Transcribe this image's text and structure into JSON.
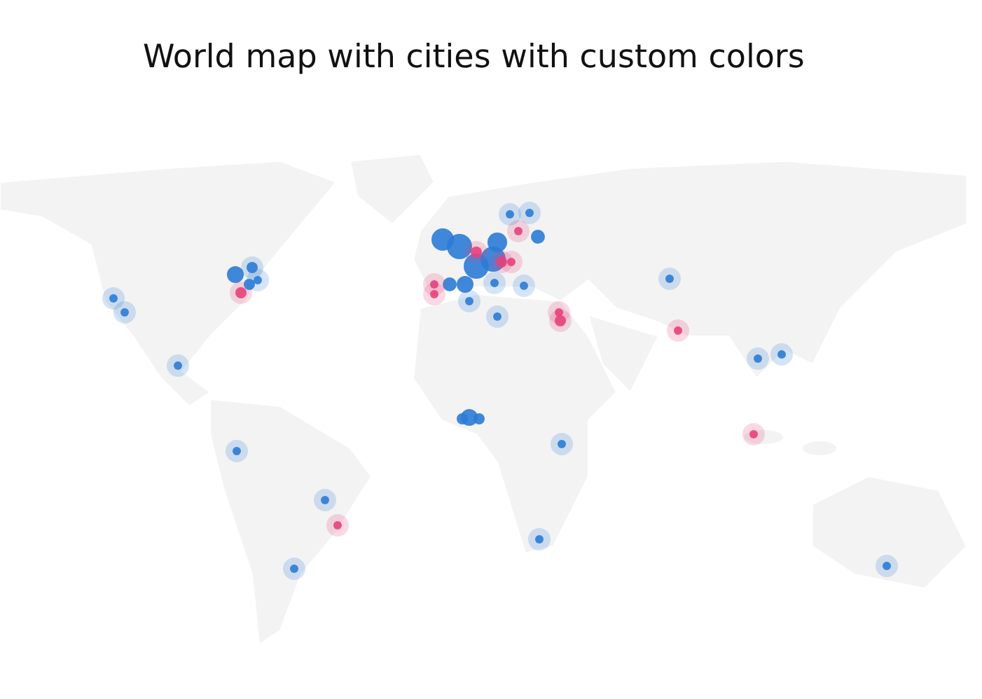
{
  "title": "World map with cities with custom colors"
}
